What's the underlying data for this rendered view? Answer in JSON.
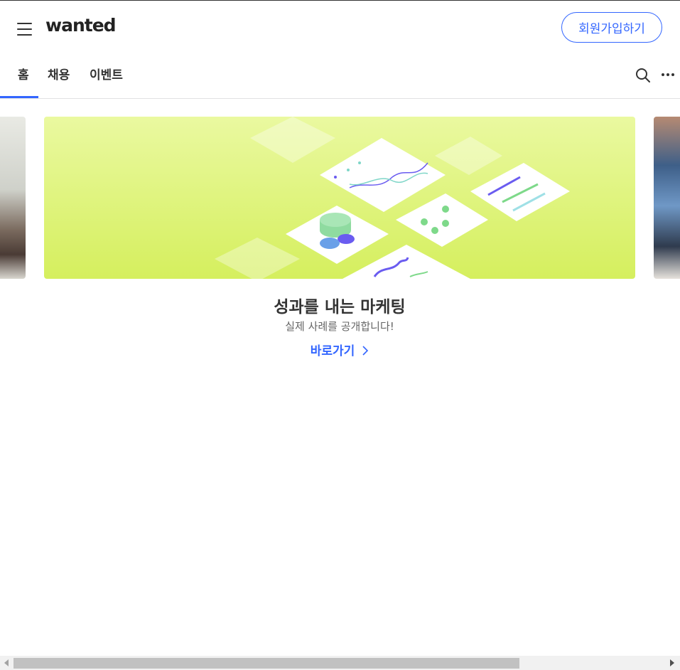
{
  "header": {
    "logo": "wanted",
    "signup_label": "회원가입하기",
    "icons": {
      "menu": "hamburger-menu-icon",
      "search": "search-icon",
      "more": "more-dots-icon"
    }
  },
  "nav": {
    "tabs": [
      {
        "label": "홈",
        "active": true
      },
      {
        "label": "채용",
        "active": false
      },
      {
        "label": "이벤트",
        "active": false
      }
    ]
  },
  "banner": {
    "title": "성과를 내는 마케팅",
    "subtitle": "실제 사례를 공개합니다!",
    "link_label": "바로가기",
    "link_icon": "chevron-right-icon"
  },
  "colors": {
    "accent": "#3366ff",
    "banner_bg": "#dff27a",
    "text": "#333333"
  }
}
